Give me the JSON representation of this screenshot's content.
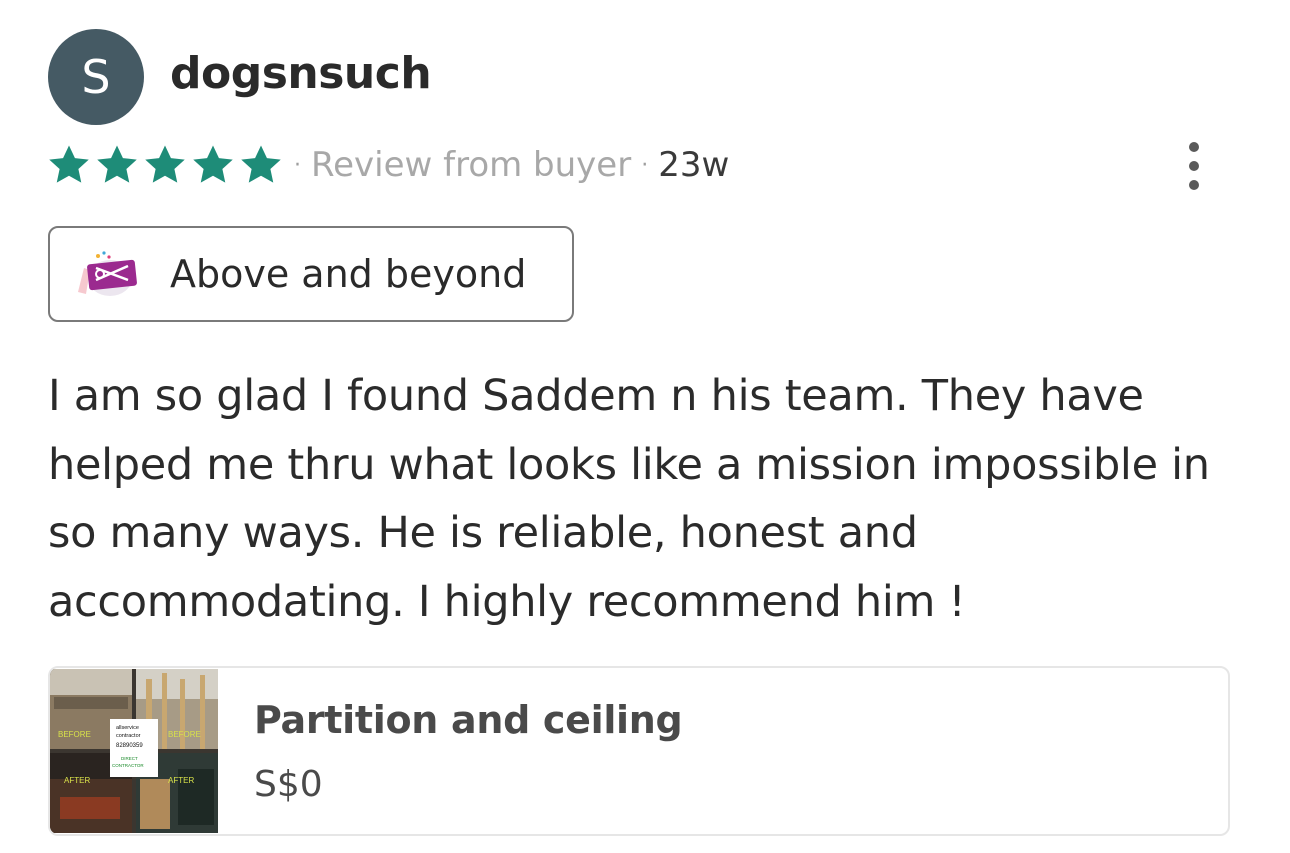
{
  "reviewer": {
    "avatar_letter": "S",
    "username": "dogsnsuch"
  },
  "rating": {
    "stars": 5,
    "max": 5,
    "color": "#1e8c78"
  },
  "meta": {
    "separator": "·",
    "source": "Review from buyer",
    "time_ago": "23w"
  },
  "badge": {
    "label": "Above and beyond",
    "icon": "gift-card-icon"
  },
  "review_text": "I am so glad I found Saddem n his team. They have helped me thru what looks like a mission impossible in so many ways. He is reliable,  honest and accommodating. I highly recommend him !",
  "item": {
    "title": "Partition and ceiling",
    "price": "S$0",
    "thumbnail": {
      "labels": [
        "BEFORE",
        "BEFORE",
        "AFTER",
        "AFTER"
      ],
      "sign_lines": [
        "allservice",
        "contractor",
        "82890359",
        "DIRECT",
        "CONTRACTOR"
      ]
    }
  },
  "colors": {
    "avatar_bg": "#455a64",
    "star_green": "#1e8c78",
    "muted_text": "#a8a8a8"
  }
}
